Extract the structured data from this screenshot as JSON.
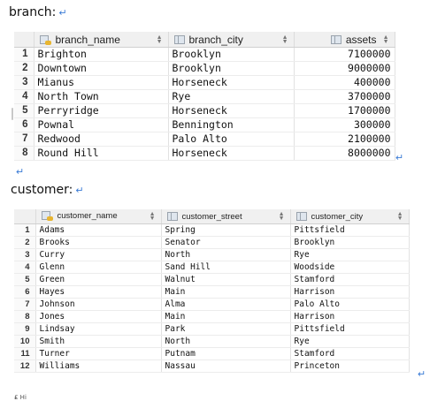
{
  "branch_label": "branch:",
  "customer_label": "customer:",
  "footer_text": "₤ Hi",
  "branch": {
    "columns": [
      "branch_name",
      "branch_city",
      "assets"
    ],
    "rows": [
      [
        "1",
        "Brighton",
        "Brooklyn",
        "7100000"
      ],
      [
        "2",
        "Downtown",
        "Brooklyn",
        "9000000"
      ],
      [
        "3",
        "Mianus",
        "Horseneck",
        "400000"
      ],
      [
        "4",
        "North Town",
        "Rye",
        "3700000"
      ],
      [
        "5",
        "Perryridge",
        "Horseneck",
        "1700000"
      ],
      [
        "6",
        "Pownal",
        "Bennington",
        "300000"
      ],
      [
        "7",
        "Redwood",
        "Palo Alto",
        "2100000"
      ],
      [
        "8",
        "Round Hill",
        "Horseneck",
        "8000000"
      ]
    ]
  },
  "customer": {
    "columns": [
      "customer_name",
      "customer_street",
      "customer_city"
    ],
    "rows": [
      [
        "1",
        "Adams",
        "Spring",
        "Pittsfield"
      ],
      [
        "2",
        "Brooks",
        "Senator",
        "Brooklyn"
      ],
      [
        "3",
        "Curry",
        "North",
        "Rye"
      ],
      [
        "4",
        "Glenn",
        "Sand Hill",
        "Woodside"
      ],
      [
        "5",
        "Green",
        "Walnut",
        "Stamford"
      ],
      [
        "6",
        "Hayes",
        "Main",
        "Harrison"
      ],
      [
        "7",
        "Johnson",
        "Alma",
        "Palo Alto"
      ],
      [
        "8",
        "Jones",
        "Main",
        "Harrison"
      ],
      [
        "9",
        "Lindsay",
        "Park",
        "Pittsfield"
      ],
      [
        "10",
        "Smith",
        "North",
        "Rye"
      ],
      [
        "11",
        "Turner",
        "Putnam",
        "Stamford"
      ],
      [
        "12",
        "Williams",
        "Nassau",
        "Princeton"
      ]
    ]
  }
}
